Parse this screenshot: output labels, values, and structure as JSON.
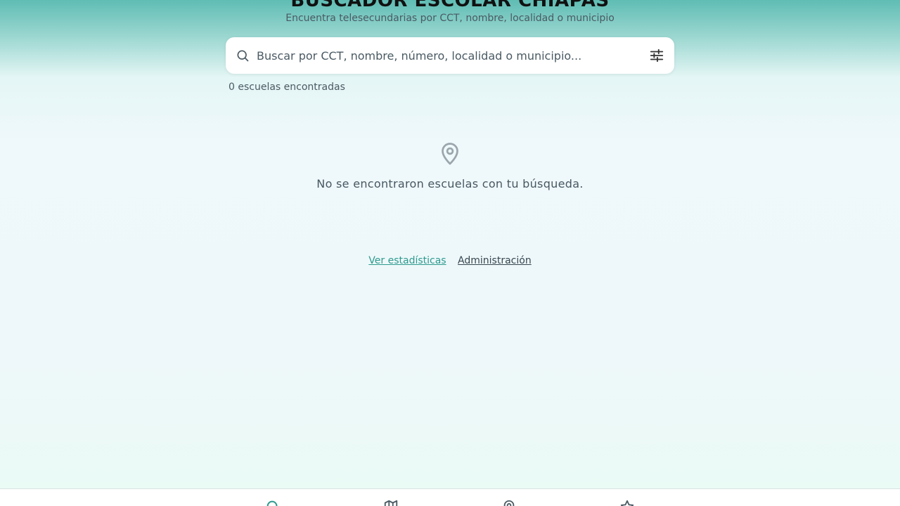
{
  "header": {
    "title": "BUSCADOR ESCOLAR CHIAPAS",
    "subtitle": "Encuentra telesecundarias por CCT, nombre, localidad o municipio"
  },
  "search": {
    "placeholder": "Buscar por CCT, nombre, número, localidad o municipio...",
    "value": "",
    "icon": "search-icon",
    "filter_icon": "sliders-icon"
  },
  "results": {
    "count_text": "0 escuelas encontradas"
  },
  "empty_state": {
    "icon": "map-pin-icon",
    "message": "No se encontraron escuelas con tu búsqueda."
  },
  "footer": {
    "stats_link": "Ver estadísticas",
    "admin_link": "Administración"
  },
  "bottom_nav": {
    "items": [
      {
        "icon": "search-icon",
        "active": true
      },
      {
        "icon": "map-icon",
        "active": false
      },
      {
        "icon": "map-pin-icon",
        "active": false
      },
      {
        "icon": "star-icon",
        "active": false
      }
    ]
  },
  "colors": {
    "accent": "#2e9a8e",
    "header_gradient_top": "#5fbdb4",
    "background": "#eff8fb"
  }
}
